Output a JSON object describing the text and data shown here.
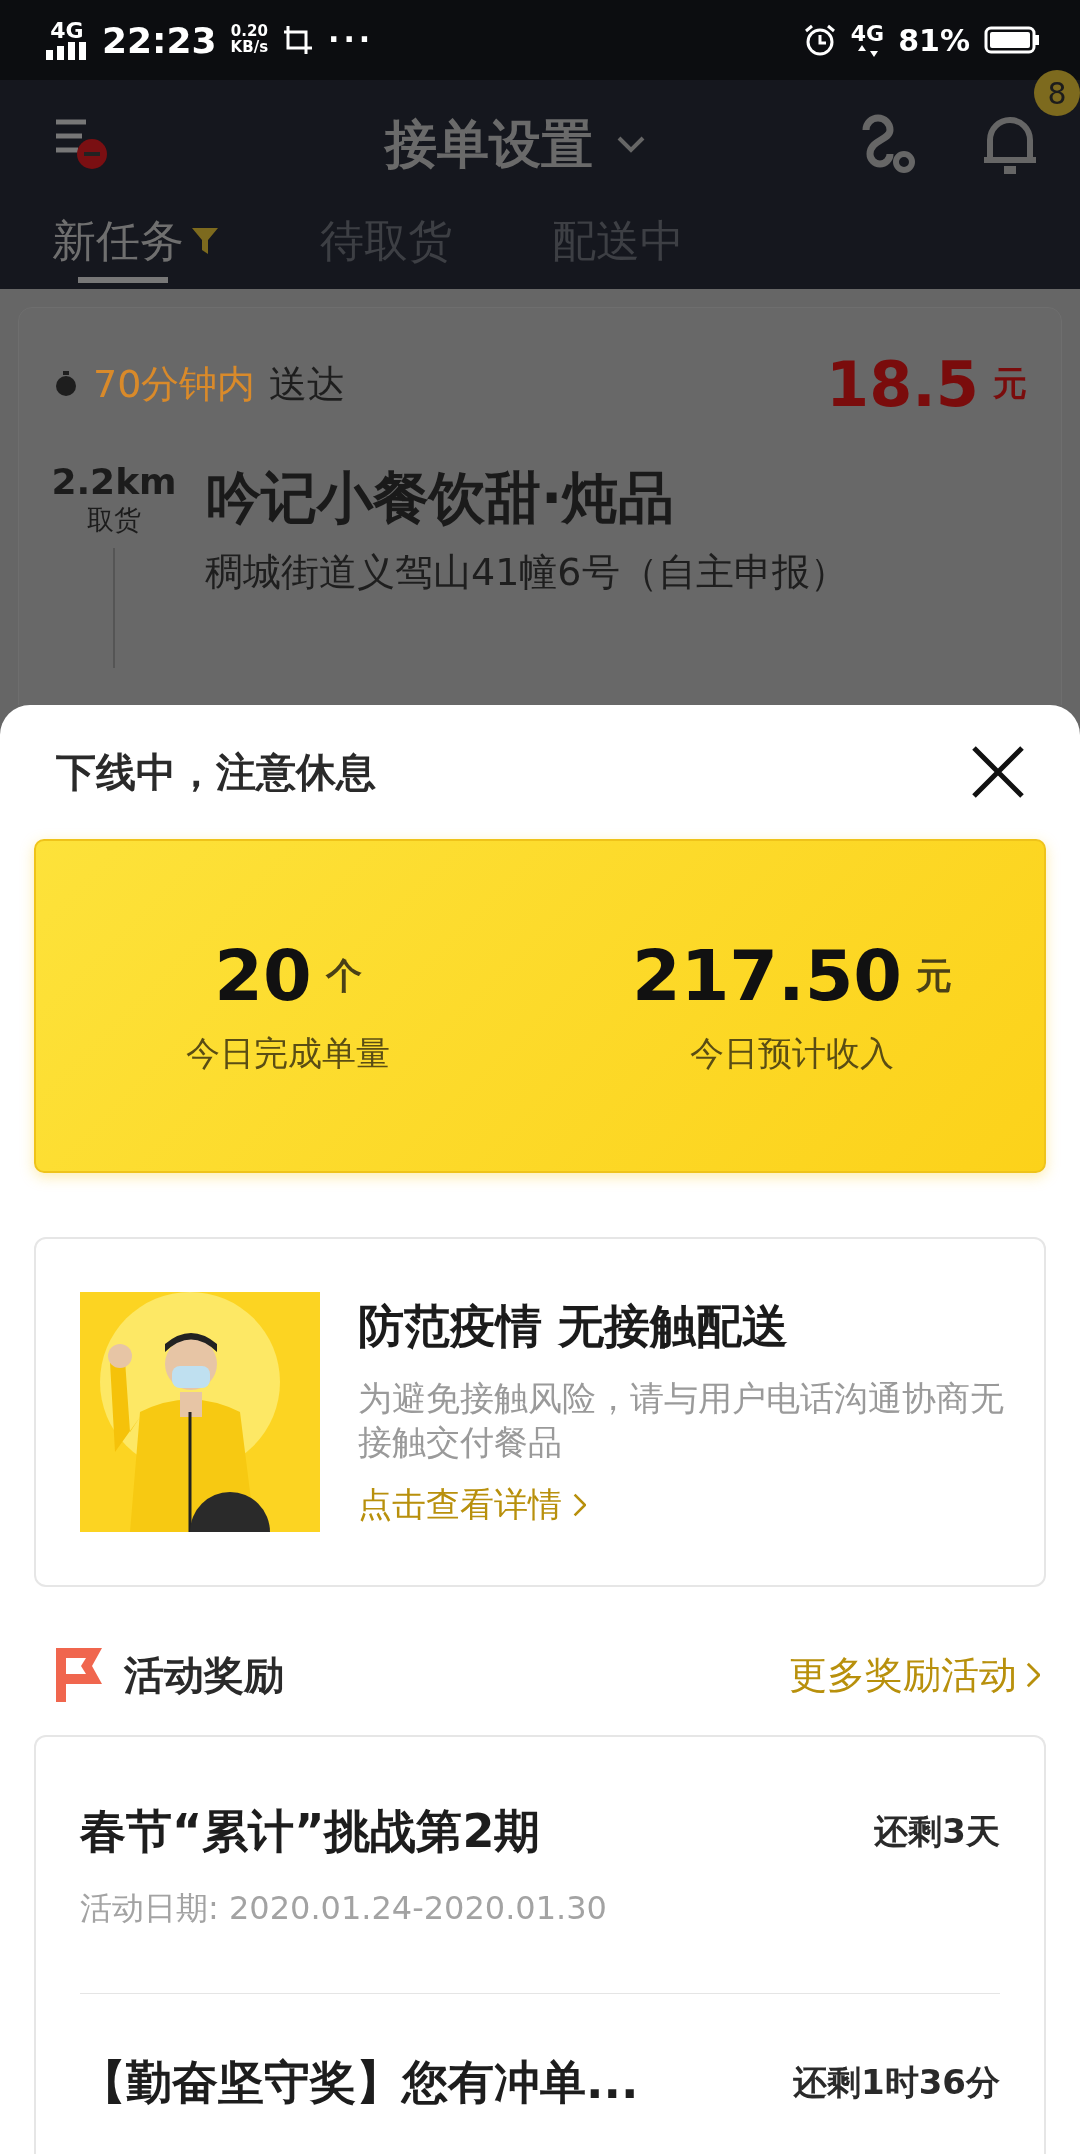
{
  "status_bar": {
    "network": "4G",
    "time": "22:23",
    "speed_value": "0.20",
    "speed_unit": "KB/s",
    "more": "···",
    "network_right": "4G",
    "battery": "81%"
  },
  "header": {
    "title": "接单设置",
    "badge": "8"
  },
  "tabs": [
    {
      "label": "新任务",
      "selected": true,
      "filter": true
    },
    {
      "label": "待取货",
      "selected": false,
      "filter": false
    },
    {
      "label": "配送中",
      "selected": false,
      "filter": false
    }
  ],
  "order": {
    "time_limit": "70分钟内",
    "time_suffix": "送达",
    "price": "18.5",
    "price_unit": "元",
    "distance": "2.2km",
    "distance_label": "取货",
    "shop": "吟记小餐饮甜·炖品",
    "address": "稠城街道义驾山41幢6号（自主申报）"
  },
  "sheet": {
    "title": "下线中，注意休息",
    "stats": [
      {
        "value": "20",
        "unit": "个",
        "label": "今日完成单量"
      },
      {
        "value": "217.50",
        "unit": "元",
        "label": "今日预计收入"
      }
    ],
    "promo": {
      "title": "防范疫情 无接触配送",
      "text": "为避免接触风险，请与用户电话沟通协商无接触交付餐品",
      "link": "点击查看详情"
    },
    "rewards": {
      "title": "活动奖励",
      "more": "更多奖励活动",
      "items": [
        {
          "title": "春节“累计”挑战第2期",
          "date": "活动日期: 2020.01.24-2020.01.30",
          "remaining": "还剩3天"
        },
        {
          "title": "【勤奋坚守奖】您有冲单...",
          "remaining": "还剩1时36分"
        }
      ]
    }
  }
}
